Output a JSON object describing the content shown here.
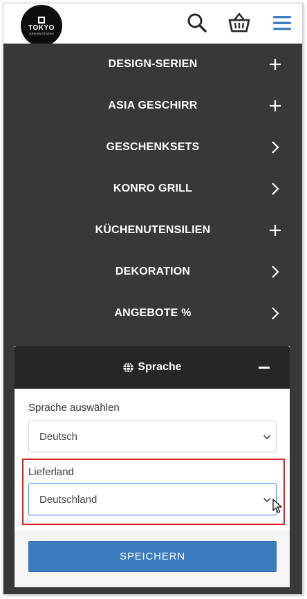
{
  "header": {
    "logo": {
      "word": "TOKYO",
      "sub": "DESIGN STUDIO"
    },
    "icons": [
      "search-icon",
      "basket-icon",
      "menu-icon"
    ]
  },
  "nav": {
    "items": [
      {
        "label": "DESIGN-SERIEN",
        "toggle": "plus"
      },
      {
        "label": "ASIA GESCHIRR",
        "toggle": "plus"
      },
      {
        "label": "GESCHENKSETS",
        "toggle": "chevron"
      },
      {
        "label": "KONRO GRILL",
        "toggle": "chevron"
      },
      {
        "label": "KÜCHENUTENSILIEN",
        "toggle": "plus"
      },
      {
        "label": "DEKORATION",
        "toggle": "chevron"
      },
      {
        "label": "ANGEBOTE %",
        "toggle": "chevron"
      }
    ]
  },
  "language": {
    "title": "Sprache",
    "language_label": "Sprache auswählen",
    "language_value": "Deutsch",
    "country_label": "Lieferland",
    "country_value": "Deutschland",
    "save_label": "SPEICHERN"
  },
  "colors": {
    "nav_bg": "#383838",
    "panel_head_bg": "#262626",
    "accent": "#3a7cc0",
    "highlight": "#e02020"
  }
}
